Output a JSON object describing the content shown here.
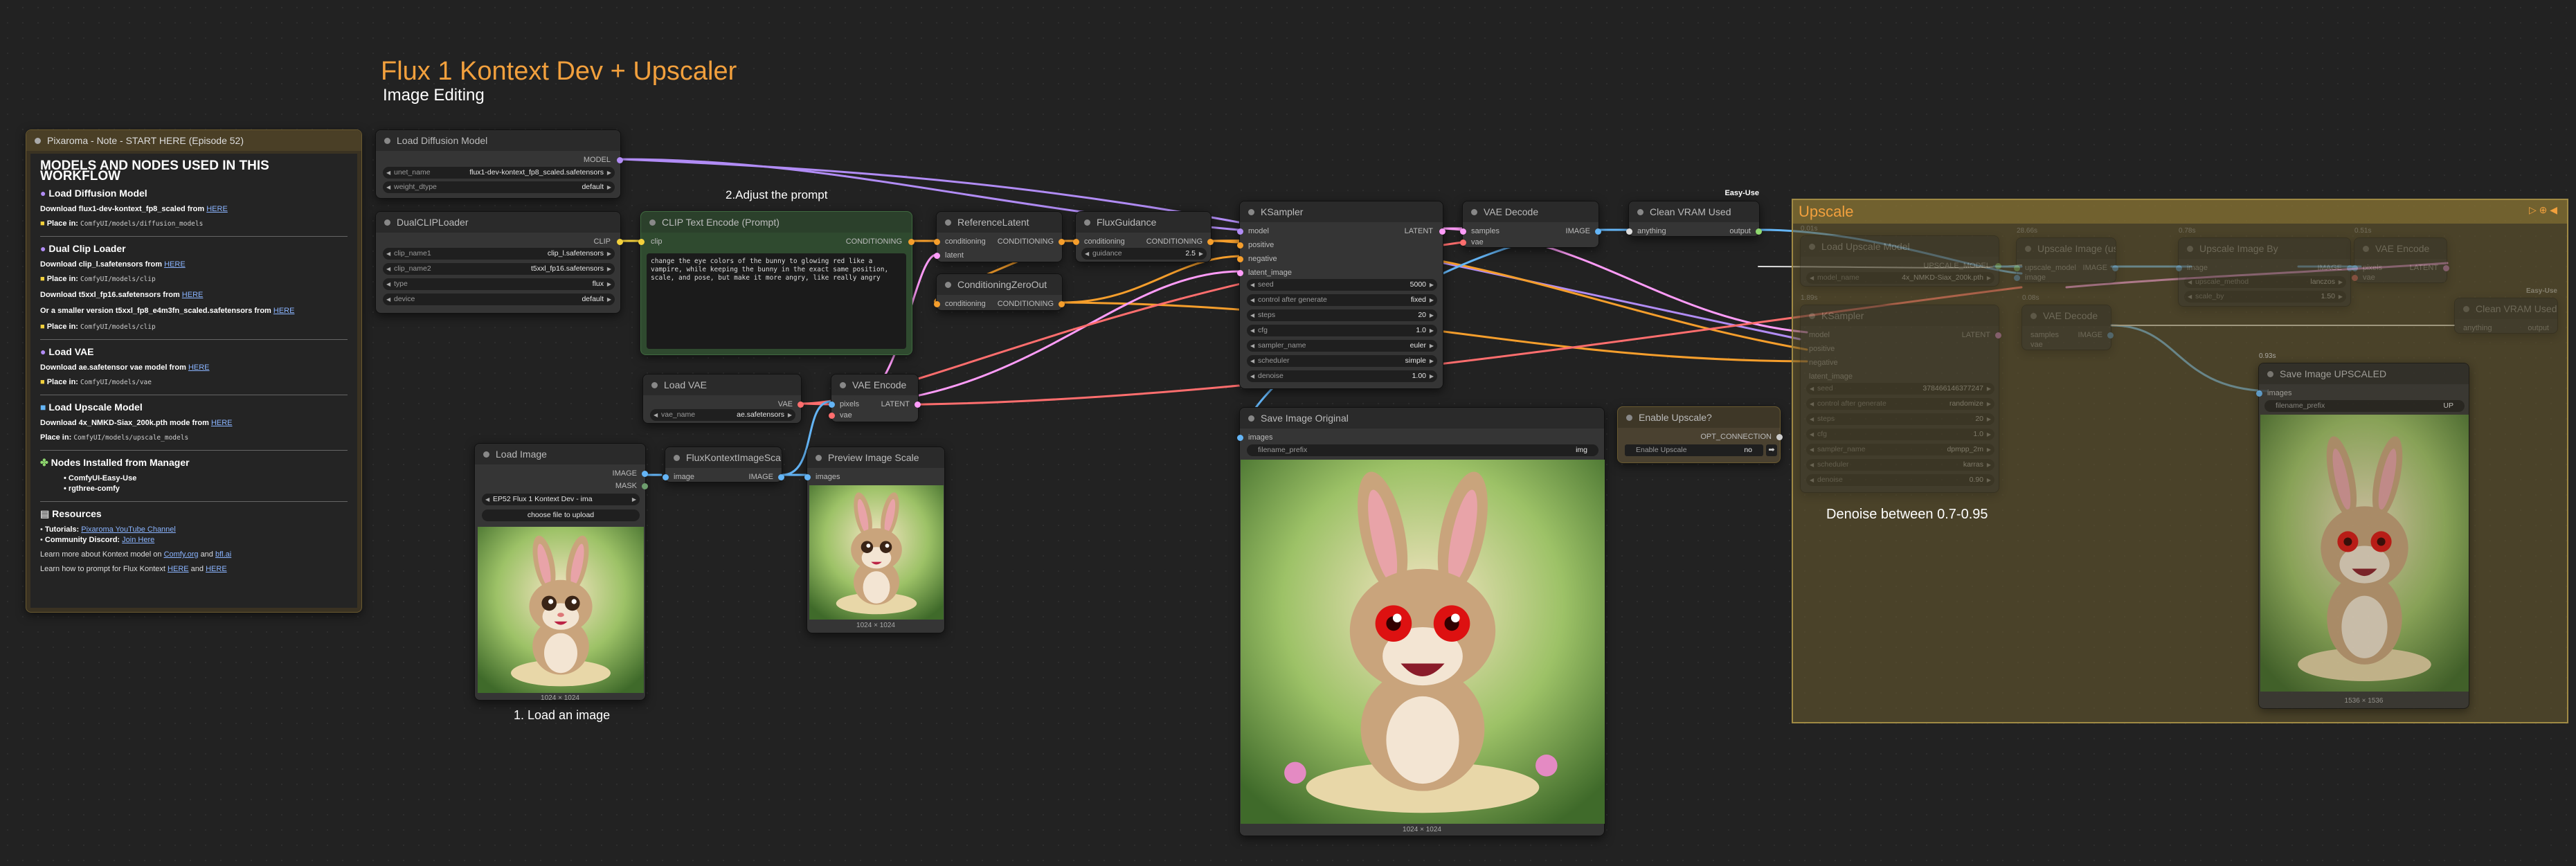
{
  "title": "Flux 1 Kontext Dev + Upscaler",
  "subtitle": "Image Editing",
  "labels": {
    "adjust": "2.Adjust the prompt",
    "load": "1. Load an image",
    "denoise": "Denoise between 0.7-0.95"
  },
  "colors": {
    "accent_title": "#f2a03d",
    "model": "#b18cf5",
    "clip": "#f2d03c",
    "cond": "#f59e2c",
    "image": "#64b5f6",
    "latent": "#ff9cf9",
    "vae": "#ff6e6e",
    "group_bg": "#4a4130",
    "group_border": "#a08a44",
    "note_bg": "#3a3222"
  },
  "note": {
    "title": "Pixaroma - Note - START HERE (Episode 52)",
    "heading": "MODELS AND NODES USED IN THIS WORKFLOW",
    "s1": "Load Diffusion Model",
    "s1_dl": "Download flux1-dev-kontext_fp8_scaled from",
    "s1_link": "HERE",
    "s1_place": "Place in:",
    "s1_path": "ComfyUI/models/diffusion_models",
    "s2": "Dual Clip Loader",
    "s2_dl": "Download clip_l.safetensors from",
    "s2_link": "HERE",
    "s2_place": "Place in:",
    "s2_path": "ComfyUI/models/clip",
    "s2_dl2": "Download t5xxl_fp16.safetensors from",
    "s2_link2": "HERE",
    "s2_alt": "Or a smaller version t5xxl_fp8_e4m3fn_scaled.safetensors from",
    "s2_link3": "HERE",
    "s2_place2": "Place in:",
    "s2_path2": "ComfyUI/models/clip",
    "s3": "Load VAE",
    "s3_dl": "Download ae.safetensor vae model from",
    "s3_link": "HERE",
    "s3_place": "Place in:",
    "s3_path": "ComfyUI/models/vae",
    "s4": "Load Upscale Model",
    "s4_dl": "Download 4x_NMKD-Siax_200k.pth mode from",
    "s4_link": "HERE",
    "s4_place": "Place in:",
    "s4_path": "ComfyUI/models/upscale_models",
    "s5": "Nodes Installed from Manager",
    "s5_i1": "ComfyUI-Easy-Use",
    "s5_i2": "rgthree-comfy",
    "s6": "Resources",
    "s6_tut": "Tutorials:",
    "s6_tut_link": "Pixaroma YouTube Channel",
    "s6_disc": "Community Discord:",
    "s6_disc_link": "Join Here",
    "s6_more": "Learn more about Kontext model on",
    "s6_more_l1": "Comfy.org",
    "s6_and": "and",
    "s6_more_l2": "bfl.ai",
    "s6_prompt": "Learn how to prompt for Flux Kontext",
    "s6_prompt_l1": "HERE",
    "s6_prompt_l2": "HERE"
  },
  "load_diffusion": {
    "title": "Load Diffusion Model",
    "out": "MODEL",
    "unet_label": "unet_name",
    "unet_value": "flux1-dev-kontext_fp8_scaled.safetensors",
    "dtype_label": "weight_dtype",
    "dtype_value": "default"
  },
  "dualclip": {
    "title": "DualCLIPLoader",
    "out": "CLIP",
    "w": [
      {
        "l": "clip_name1",
        "v": "clip_l.safetensors"
      },
      {
        "l": "clip_name2",
        "v": "t5xxl_fp16.safetensors"
      },
      {
        "l": "type",
        "v": "flux"
      },
      {
        "l": "device",
        "v": "default"
      }
    ]
  },
  "clip_text": {
    "title": "CLIP Text Encode (Prompt)",
    "in": "clip",
    "out": "CONDITIONING",
    "prompt": "change the eye colors of the bunny to glowing red like a vampire, while keeping the bunny in the exact same position, scale, and pose, but make it more angry, like really angry"
  },
  "ref_latent": {
    "title": "ReferenceLatent",
    "in1": "conditioning",
    "in2": "latent",
    "out": "CONDITIONING"
  },
  "flux_guidance": {
    "title": "FluxGuidance",
    "in": "conditioning",
    "out": "CONDITIONING",
    "w_label": "guidance",
    "w_value": "2.5"
  },
  "cond_zero": {
    "title": "ConditioningZeroOut",
    "in": "conditioning",
    "out": "CONDITIONING"
  },
  "ksampler": {
    "title": "KSampler",
    "ins": [
      "model",
      "positive",
      "negative",
      "latent_image"
    ],
    "out": "LATENT",
    "w": [
      {
        "l": "seed",
        "v": "5000"
      },
      {
        "l": "control after generate",
        "v": "fixed"
      },
      {
        "l": "steps",
        "v": "20"
      },
      {
        "l": "cfg",
        "v": "1.0"
      },
      {
        "l": "sampler_name",
        "v": "euler"
      },
      {
        "l": "scheduler",
        "v": "simple"
      },
      {
        "l": "denoise",
        "v": "1.00"
      }
    ]
  },
  "vae_decode": {
    "title": "VAE Decode",
    "in1": "samples",
    "in2": "vae",
    "out": "IMAGE"
  },
  "clean_vram": {
    "title": "Clean VRAM Used",
    "badge": "Easy-Use",
    "in": "anything",
    "out": "output"
  },
  "load_vae": {
    "title": "Load VAE",
    "out": "VAE",
    "w_label": "vae_name",
    "w_value": "ae.safetensors"
  },
  "vae_encode": {
    "title": "VAE Encode",
    "in1": "pixels",
    "in2": "vae",
    "out": "LATENT"
  },
  "load_image": {
    "title": "Load Image",
    "out1": "IMAGE",
    "out2": "MASK",
    "file": "EP52 Flux 1 Kontext Dev - ima",
    "upload": "choose file to upload",
    "size": "1024 × 1024"
  },
  "flux_scale": {
    "title": "FluxKontextImageScale",
    "in": "image",
    "out": "IMAGE"
  },
  "preview": {
    "title": "Preview Image Scale",
    "in": "images",
    "size": "1024 × 1024"
  },
  "save_orig": {
    "title": "Save Image Original",
    "in": "images",
    "w_label": "filename_prefix",
    "w_value": "img",
    "size": "1024 × 1024"
  },
  "enable_up": {
    "title": "Enable Upscale?",
    "out": "OPT_CONNECTION",
    "w_label": "Enable Upscale",
    "w_value": "no"
  },
  "upscale": {
    "title": "Upscale",
    "load_model": "Load Upscale Model",
    "lm_out": "UPSCALE_MODEL",
    "lm_w_label": "model_name",
    "lm_w_value": "4x_NMKD-Siax_200k.pth",
    "using": "Upscale Image (using Model)",
    "using_in1": "upscale_model",
    "using_in2": "image",
    "using_out": "IMAGE",
    "by": "Upscale Image By",
    "by_in": "image",
    "by_out": "IMAGE",
    "by_w1_label": "upscale_method",
    "by_w1_value": "lanczos",
    "by_w2_label": "scale_by",
    "by_w2_value": "1.50",
    "vae_enc": "VAE Encode",
    "ve_in1": "pixels",
    "ve_in2": "vae",
    "ve_out": "LATENT",
    "ks": "KSampler",
    "ks_ins": [
      "model",
      "positive",
      "negative",
      "latent_image"
    ],
    "ks_out": "LATENT",
    "ks_w": [
      {
        "l": "seed",
        "v": "378466146377247"
      },
      {
        "l": "control after generate",
        "v": "randomize"
      },
      {
        "l": "steps",
        "v": "20"
      },
      {
        "l": "cfg",
        "v": "1.0"
      },
      {
        "l": "sampler_name",
        "v": "dpmpp_2m"
      },
      {
        "l": "scheduler",
        "v": "karras"
      },
      {
        "l": "denoise",
        "v": "0.90"
      }
    ],
    "vd": "VAE Decode",
    "vd_in1": "samples",
    "vd_in2": "vae",
    "vd_out": "IMAGE",
    "cv": "Clean VRAM Used",
    "cv_badge": "Easy-Use",
    "cv_in": "anything",
    "cv_out": "output",
    "save": "Save Image UPSCALED",
    "save_in": "images",
    "save_w_label": "filename_prefix",
    "save_w_value": "UP",
    "save_size": "1536 × 1536",
    "tag_a": "0.93s",
    "tag_b": "1.89s",
    "tag_c": "0.78s",
    "tag_d": "0.51s",
    "tag_e": "0.01s",
    "tag_f": "0.08s",
    "tag_g": "28.66s"
  }
}
